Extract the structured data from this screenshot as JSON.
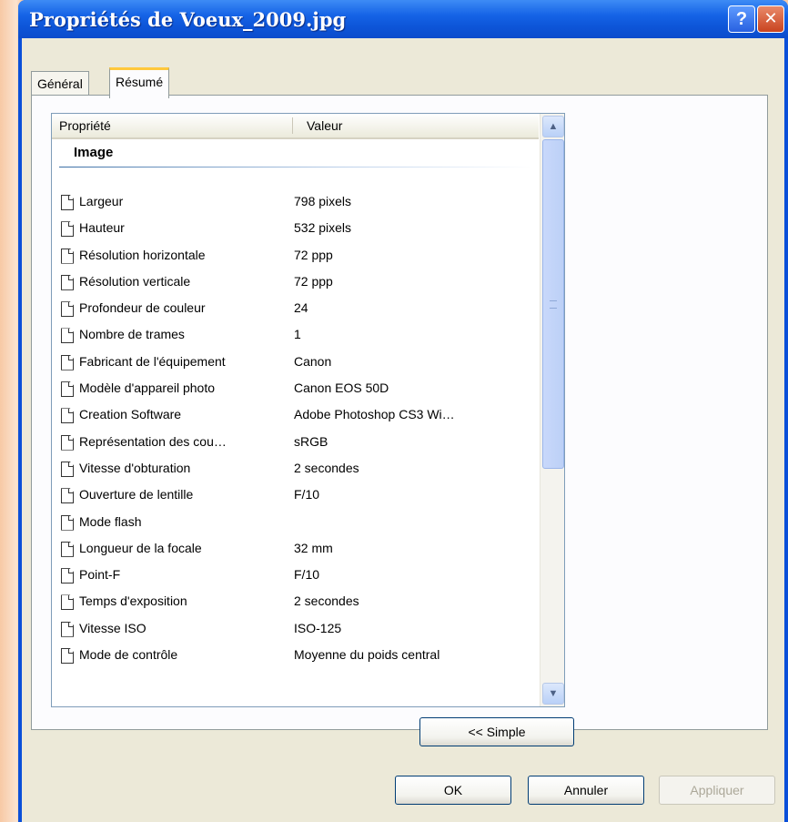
{
  "window": {
    "title": "Propriétés de Voeux_2009.jpg",
    "help_glyph": "?",
    "close_glyph": "✕"
  },
  "tabs": [
    {
      "label": "Général",
      "active": false
    },
    {
      "label": "Résumé",
      "active": true
    }
  ],
  "list": {
    "columns": {
      "property": "Propriété",
      "value": "Valeur"
    },
    "group": "Image",
    "rows": [
      {
        "name": "Largeur",
        "value": "798 pixels"
      },
      {
        "name": "Hauteur",
        "value": "532 pixels"
      },
      {
        "name": "Résolution horizontale",
        "value": "72 ppp"
      },
      {
        "name": "Résolution verticale",
        "value": "72 ppp"
      },
      {
        "name": "Profondeur de couleur",
        "value": "24"
      },
      {
        "name": "Nombre de trames",
        "value": "1"
      },
      {
        "name": "Fabricant de l'équipement",
        "value": "Canon"
      },
      {
        "name": "Modèle d'appareil photo",
        "value": "Canon EOS 50D"
      },
      {
        "name": "Creation Software",
        "value": "Adobe Photoshop CS3 Wi…"
      },
      {
        "name": "Représentation des cou…",
        "value": "sRGB"
      },
      {
        "name": "Vitesse d'obturation",
        "value": "2 secondes"
      },
      {
        "name": "Ouverture de lentille",
        "value": "F/10"
      },
      {
        "name": "Mode flash",
        "value": ""
      },
      {
        "name": "Longueur de la focale",
        "value": "32 mm"
      },
      {
        "name": "Point-F",
        "value": "F/10"
      },
      {
        "name": "Temps d'exposition",
        "value": "2 secondes"
      },
      {
        "name": "Vitesse ISO",
        "value": "ISO-125"
      },
      {
        "name": "Mode de contrôle",
        "value": "Moyenne du poids central"
      }
    ]
  },
  "buttons": {
    "simple": "<< Simple",
    "ok": "OK",
    "cancel": "Annuler",
    "apply": "Appliquer"
  },
  "colors": {
    "titlebar": "#0d55d8",
    "dialog_bg": "#ece9d8",
    "active_tab_accent": "#ffc83c"
  }
}
